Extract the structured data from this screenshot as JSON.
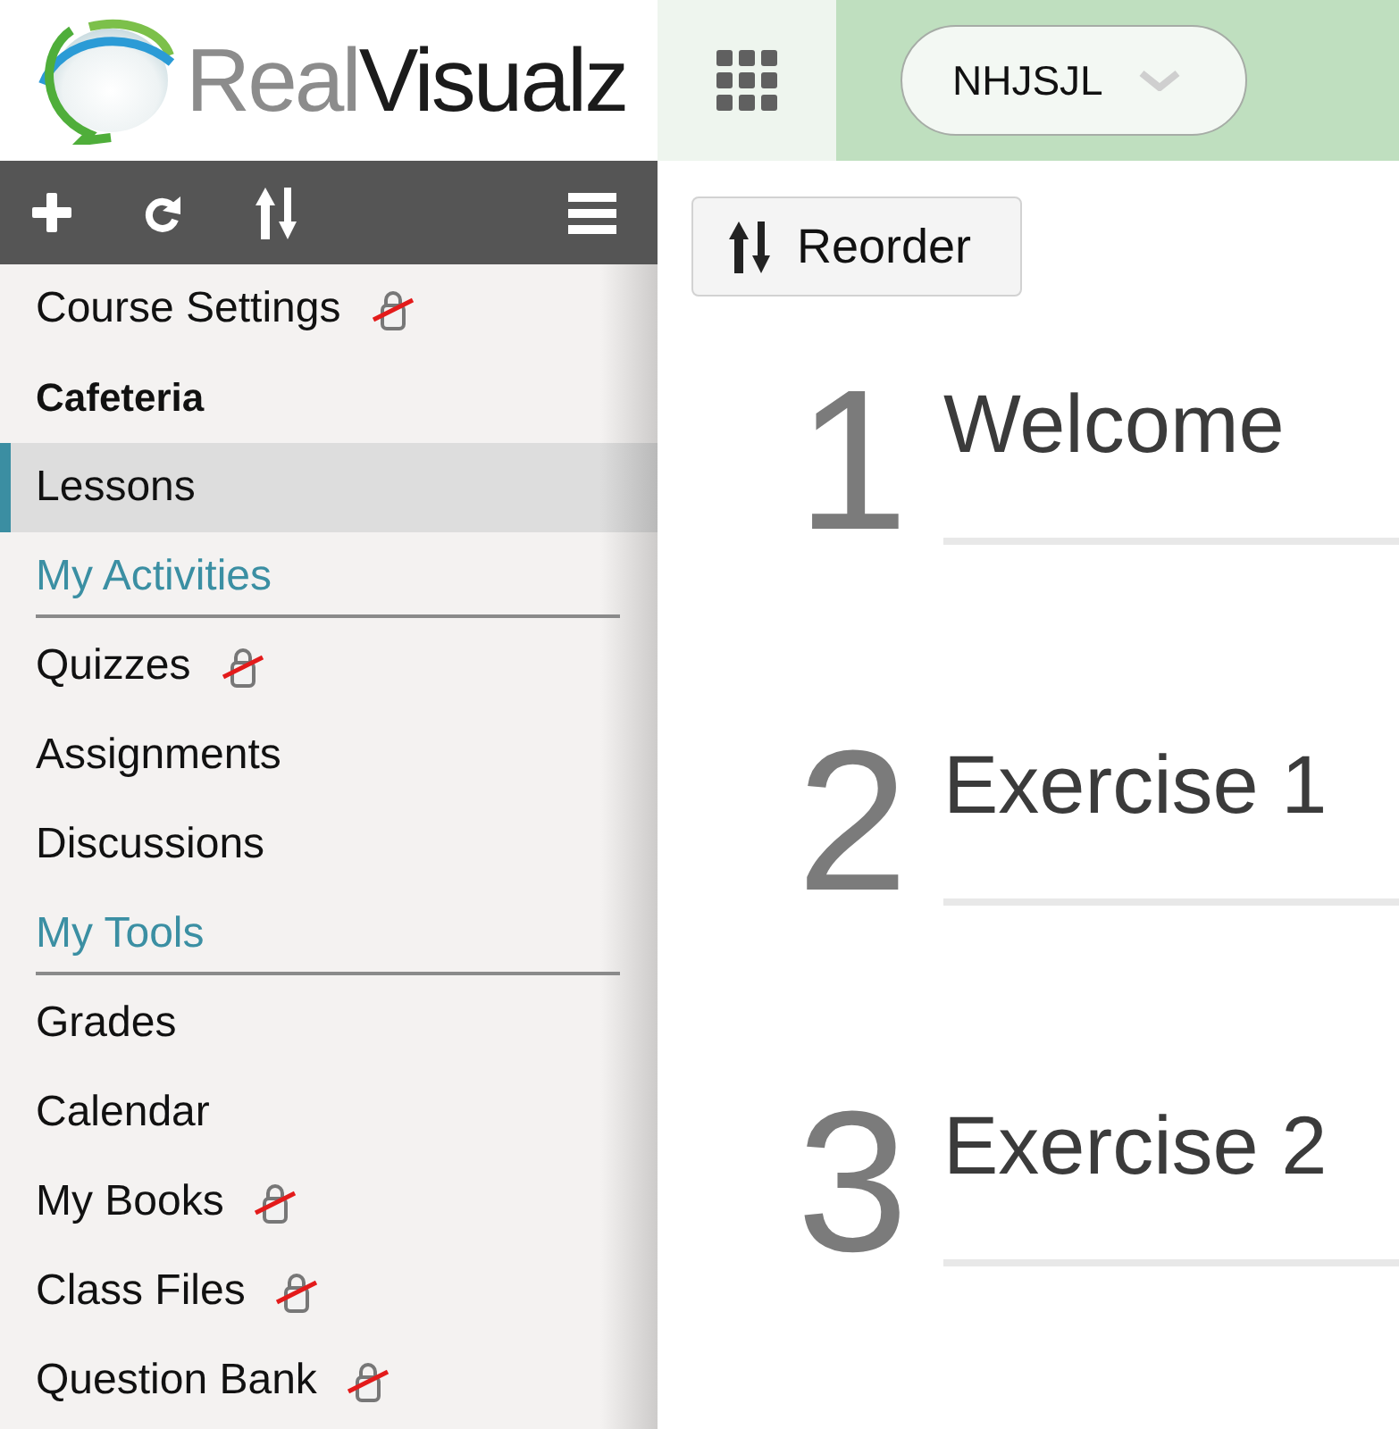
{
  "header": {
    "logo": {
      "text": "Real**Visualz**"
    },
    "course_selector": {
      "value": "NHJSJL"
    }
  },
  "sidebar": {
    "items": [
      {
        "kind": "item",
        "label": "Course Settings",
        "locked": true,
        "bold": false,
        "selected": false
      },
      {
        "kind": "item",
        "label": "Cafeteria",
        "locked": false,
        "bold": true,
        "selected": false
      },
      {
        "kind": "item",
        "label": "Lessons",
        "locked": false,
        "bold": false,
        "selected": true
      },
      {
        "kind": "heading",
        "label": "My Activities"
      },
      {
        "kind": "item",
        "label": "Quizzes",
        "locked": true,
        "bold": false,
        "selected": false
      },
      {
        "kind": "item",
        "label": "Assignments",
        "locked": false,
        "bold": false,
        "selected": false
      },
      {
        "kind": "item",
        "label": "Discussions",
        "locked": false,
        "bold": false,
        "selected": false
      },
      {
        "kind": "heading",
        "label": "My Tools"
      },
      {
        "kind": "item",
        "label": "Grades",
        "locked": false,
        "bold": false,
        "selected": false
      },
      {
        "kind": "item",
        "label": "Calendar",
        "locked": false,
        "bold": false,
        "selected": false
      },
      {
        "kind": "item",
        "label": "My Books",
        "locked": true,
        "bold": false,
        "selected": false
      },
      {
        "kind": "item",
        "label": "Class Files",
        "locked": true,
        "bold": false,
        "selected": false
      },
      {
        "kind": "item",
        "label": "Question Bank",
        "locked": true,
        "bold": false,
        "selected": false
      }
    ]
  },
  "content": {
    "reorder_button": {
      "label": "Reorder"
    },
    "lessons": [
      {
        "number": "1",
        "title": "Welcome"
      },
      {
        "number": "2",
        "title": "Exercise 1"
      },
      {
        "number": "3",
        "title": "Exercise 2"
      }
    ]
  }
}
